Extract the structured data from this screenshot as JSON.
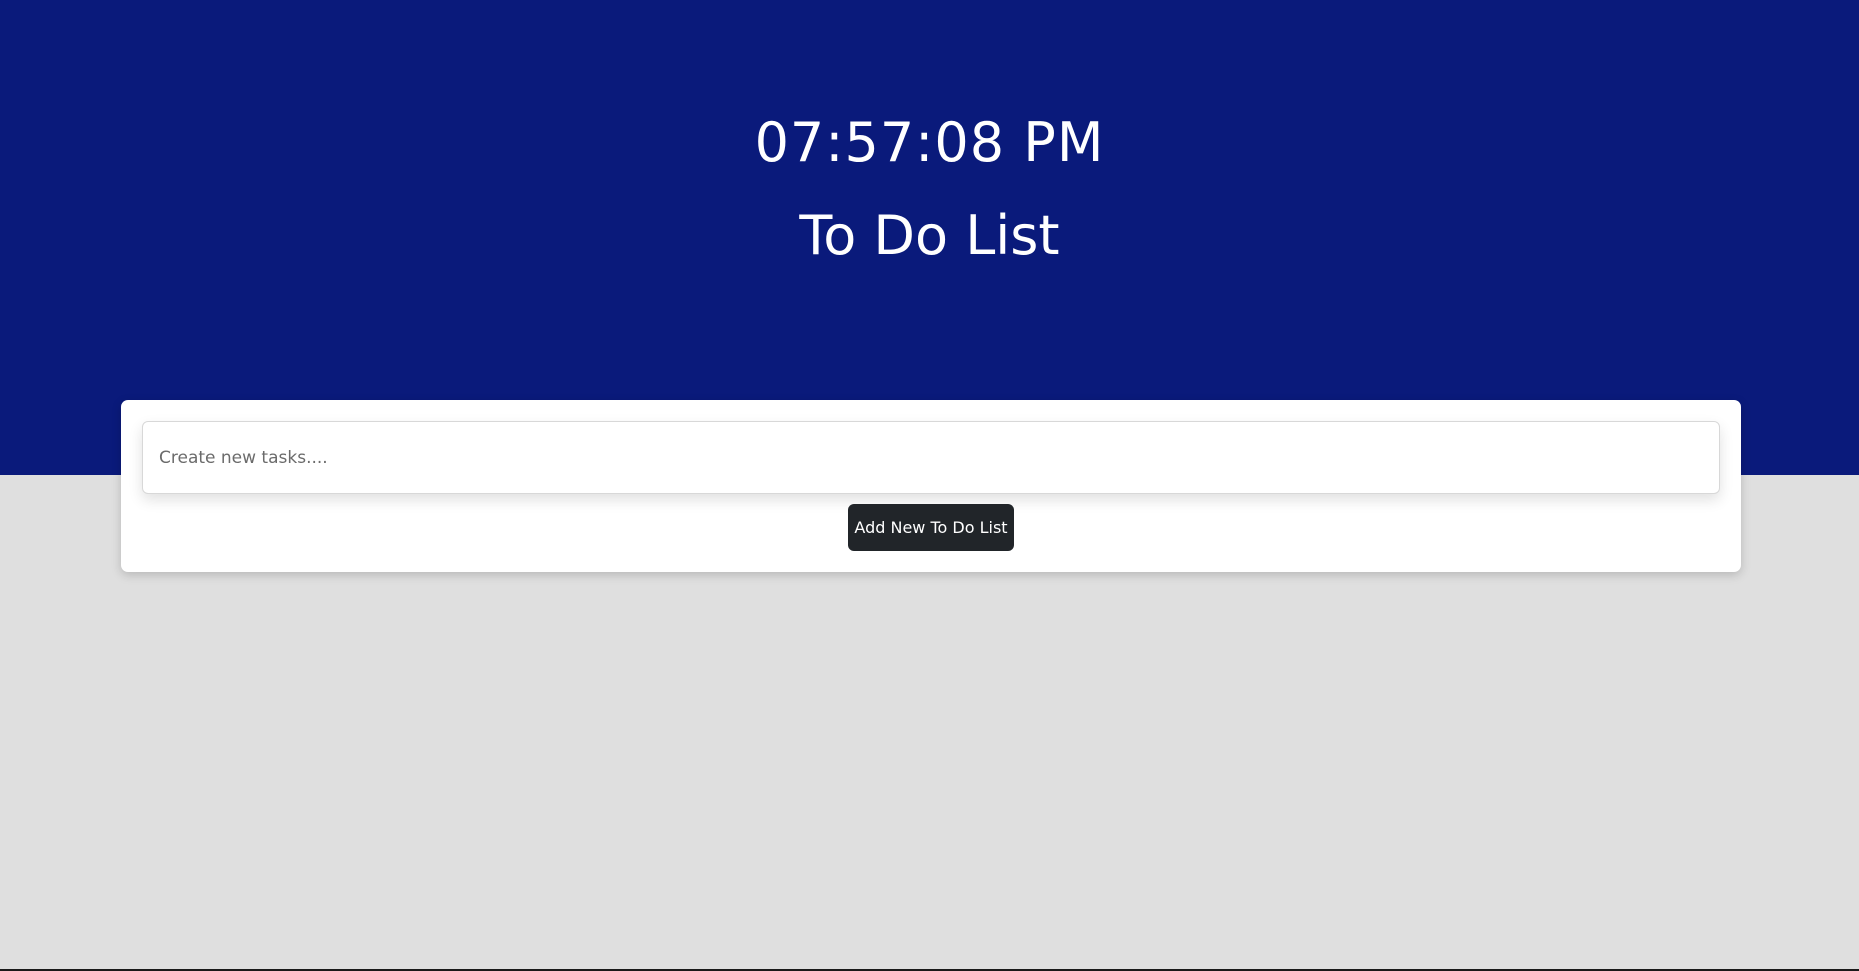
{
  "header": {
    "clock": "07:57:08 PM",
    "title": "To Do List"
  },
  "form": {
    "task_placeholder": "Create new tasks....",
    "add_button_label": "Add New To Do List"
  },
  "colors": {
    "hero_background": "#0a1a7b",
    "page_background": "#dfdfdf",
    "button_background": "#212529"
  }
}
